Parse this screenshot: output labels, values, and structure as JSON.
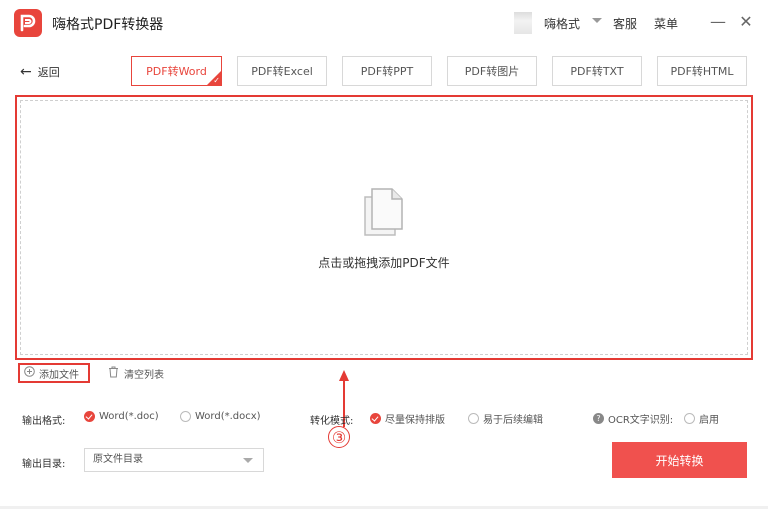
{
  "app": {
    "title": "嗨格式PDF转换器"
  },
  "header": {
    "username": "嗨格式",
    "service": "客服",
    "menu": "菜单"
  },
  "nav": {
    "back_label": "返回",
    "tabs": [
      {
        "label": "PDF转Word",
        "active": true
      },
      {
        "label": "PDF转Excel",
        "active": false
      },
      {
        "label": "PDF转PPT",
        "active": false
      },
      {
        "label": "PDF转图片",
        "active": false
      },
      {
        "label": "PDF转TXT",
        "active": false
      },
      {
        "label": "PDF转HTML",
        "active": false
      }
    ]
  },
  "dropzone": {
    "text": "点击或拖拽添加PDF文件"
  },
  "actions": {
    "add_file": "添加文件",
    "clear_list": "清空列表"
  },
  "annotation": {
    "step": "③"
  },
  "options": {
    "format_label": "输出格式:",
    "format_options": [
      {
        "label": "Word(*.doc)",
        "selected": true
      },
      {
        "label": "Word(*.docx)",
        "selected": false
      }
    ],
    "mode_label": "转化模式:",
    "mode_options": [
      {
        "label": "尽量保持排版",
        "selected": true
      },
      {
        "label": "易于后续编辑",
        "selected": false
      }
    ],
    "ocr_label": "OCR文字识别:",
    "ocr_option": {
      "label": "启用",
      "selected": false
    },
    "dir_label": "输出目录:",
    "dir_value": "原文件目录"
  },
  "start_button": "开始转换",
  "colors": {
    "accent": "#e8453c",
    "button": "#f0514e",
    "highlight": "#e43a34"
  }
}
